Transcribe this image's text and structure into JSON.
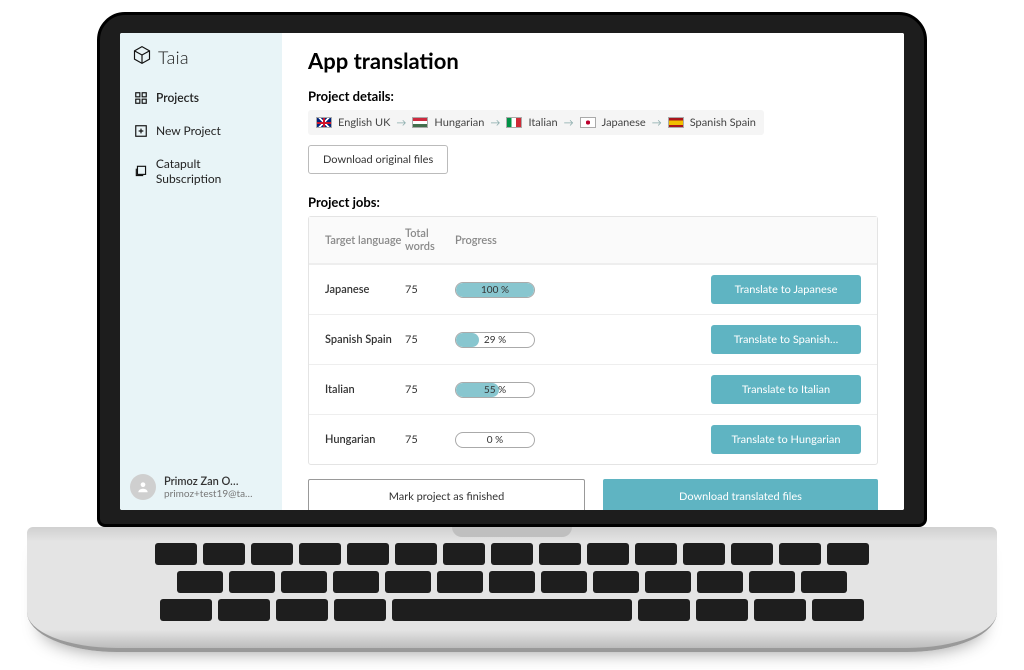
{
  "brand": "Taia",
  "sidebar": {
    "items": [
      {
        "label": "Projects",
        "icon": "grid-icon"
      },
      {
        "label": "New Project",
        "icon": "plus-icon"
      },
      {
        "label": "Catapult Subscription",
        "icon": "layers-icon"
      }
    ]
  },
  "user": {
    "name": "Primoz Zan O…",
    "email": "primoz+test19@ta…"
  },
  "page": {
    "title": "App translation",
    "details_heading": "Project details:",
    "jobs_heading": "Project jobs:",
    "download_original": "Download original files",
    "mark_finished": "Mark project as finished",
    "download_translated": "Download translated files"
  },
  "languages": [
    {
      "flag": "uk",
      "name": "English UK"
    },
    {
      "flag": "hu",
      "name": "Hungarian"
    },
    {
      "flag": "it",
      "name": "Italian"
    },
    {
      "flag": "jp",
      "name": "Japanese"
    },
    {
      "flag": "es",
      "name": "Spanish Spain"
    }
  ],
  "columns": {
    "target": "Target language",
    "words": "Total words",
    "progress": "Progress"
  },
  "jobs": [
    {
      "language": "Japanese",
      "words": "75",
      "progress": 100,
      "progress_label": "100 %",
      "action": "Translate to Japanese"
    },
    {
      "language": "Spanish Spain",
      "words": "75",
      "progress": 29,
      "progress_label": "29 %",
      "action": "Translate to Spanish…"
    },
    {
      "language": "Italian",
      "words": "75",
      "progress": 55,
      "progress_label": "55 %",
      "action": "Translate to Italian"
    },
    {
      "language": "Hungarian",
      "words": "75",
      "progress": 0,
      "progress_label": "0 %",
      "action": "Translate to Hungarian"
    }
  ],
  "colors": {
    "accent": "#5fb4c2",
    "sidebar_bg": "#e8f4f7"
  }
}
